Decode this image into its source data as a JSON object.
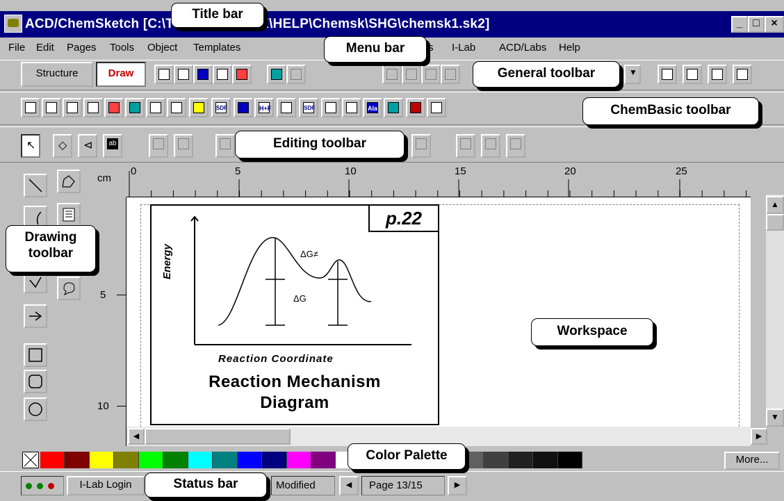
{
  "window": {
    "title": "ACD/ChemSketch [C:\\TMP\\ACDWORK\\HELP\\Chemsk\\SHG\\chemsk1.sk2]",
    "controls": {
      "minimize": "_",
      "maximize": "□",
      "close": "×"
    }
  },
  "menu": {
    "items": [
      "File",
      "Edit",
      "Pages",
      "Tools",
      "Object",
      "Templates",
      "s",
      "I-Lab",
      "ACD/Labs",
      "Help"
    ]
  },
  "general_toolbar": {
    "mode_structure": "Structure",
    "mode_draw": "Draw",
    "icons": [
      "new-page-icon",
      "open-icon",
      "save-icon",
      "print-icon",
      "pdf-export-icon",
      "undo-icon",
      "redo-icon",
      "eraser-icon",
      "cut-icon",
      "copy-icon",
      "paste-icon",
      "zoom-dropdown-icon",
      "ring-tool-icon",
      "ring-tool-2-icon",
      "ring-tool-3-icon",
      "ring-tool-4-icon"
    ]
  },
  "chembasic_toolbar": {
    "icons": [
      "clean-structure-icon",
      "3d-optimize-icon",
      "check-tautomers-icon",
      "flip-icon",
      "fire-icon",
      "calc-properties-icon",
      "template-window-icon",
      "table-icon",
      "open-folder-icon",
      "sdf-icon",
      "grid-icon",
      "h-f-icon",
      "nomenclature-icon",
      "sdf-2-icon",
      "spectrum-icon",
      "flask-icon",
      "amino-acid-icon",
      "gear-icon",
      "dna-icon",
      "macro-icon"
    ],
    "hf_label": "H+F",
    "ala_label": "Ala",
    "sdf_label": "SDF"
  },
  "editing_toolbar": {
    "icons": [
      "select-arrow-icon",
      "rotate-icon",
      "lasso-icon",
      "text-box-icon",
      "group-icon",
      "ungroup-icon",
      "align-icon",
      "distribute-icon",
      "align-left-icon",
      "align-center-icon",
      "align-top-icon"
    ],
    "text_box_label": "ab"
  },
  "drawing_toolbar": {
    "tools": [
      "line-icon",
      "polyline-icon",
      "arc-icon",
      "text-frame-icon",
      "bezier-icon",
      "callout-icon",
      "arrow-icon",
      "rectangle-icon",
      "rounded-rectangle-icon",
      "ellipse-icon"
    ]
  },
  "rulers": {
    "unit": "cm",
    "horizontal_labels": [
      "0",
      "5",
      "10",
      "15",
      "20",
      "25"
    ],
    "vertical_labels": [
      "5",
      "10"
    ]
  },
  "diagram": {
    "page_label": "p.22",
    "y_axis_label": "Energy",
    "x_axis_label": "Reaction Coordinate",
    "delta_g_label": "ΔG",
    "delta_g_ts_label": "ΔG≠",
    "title_line1": "Reaction Mechanism",
    "title_line2": "Diagram"
  },
  "palette": {
    "no_color_icon": "x-icon",
    "colors": [
      "#ff0000",
      "#800000",
      "#ffff00",
      "#808000",
      "#00ff00",
      "#008000",
      "#00ffff",
      "#008080",
      "#0000ff",
      "#000080",
      "#ff00ff",
      "#800080",
      "#ffffff",
      "#e0e0e0",
      "#c0c0c0",
      "#a0a0a0",
      "#808080",
      "#606060",
      "#404040",
      "#202020",
      "#101010",
      "#000000"
    ],
    "more_label": "More..."
  },
  "status_bar": {
    "indicator_colors": [
      "#008000",
      "#008000",
      "#c00000"
    ],
    "ilab_login": "I-Lab Login",
    "modified": "Modified",
    "page_info": "Page 13/15"
  },
  "callouts": {
    "title_bar": "Title bar",
    "menu_bar": "Menu bar",
    "general_toolbar": "General toolbar",
    "chembasic_toolbar": "ChemBasic toolbar",
    "editing_toolbar": "Editing toolbar",
    "drawing_toolbar_line1": "Drawing",
    "drawing_toolbar_line2": "toolbar",
    "workspace": "Workspace",
    "color_palette": "Color Palette",
    "status_bar": "Status bar"
  }
}
